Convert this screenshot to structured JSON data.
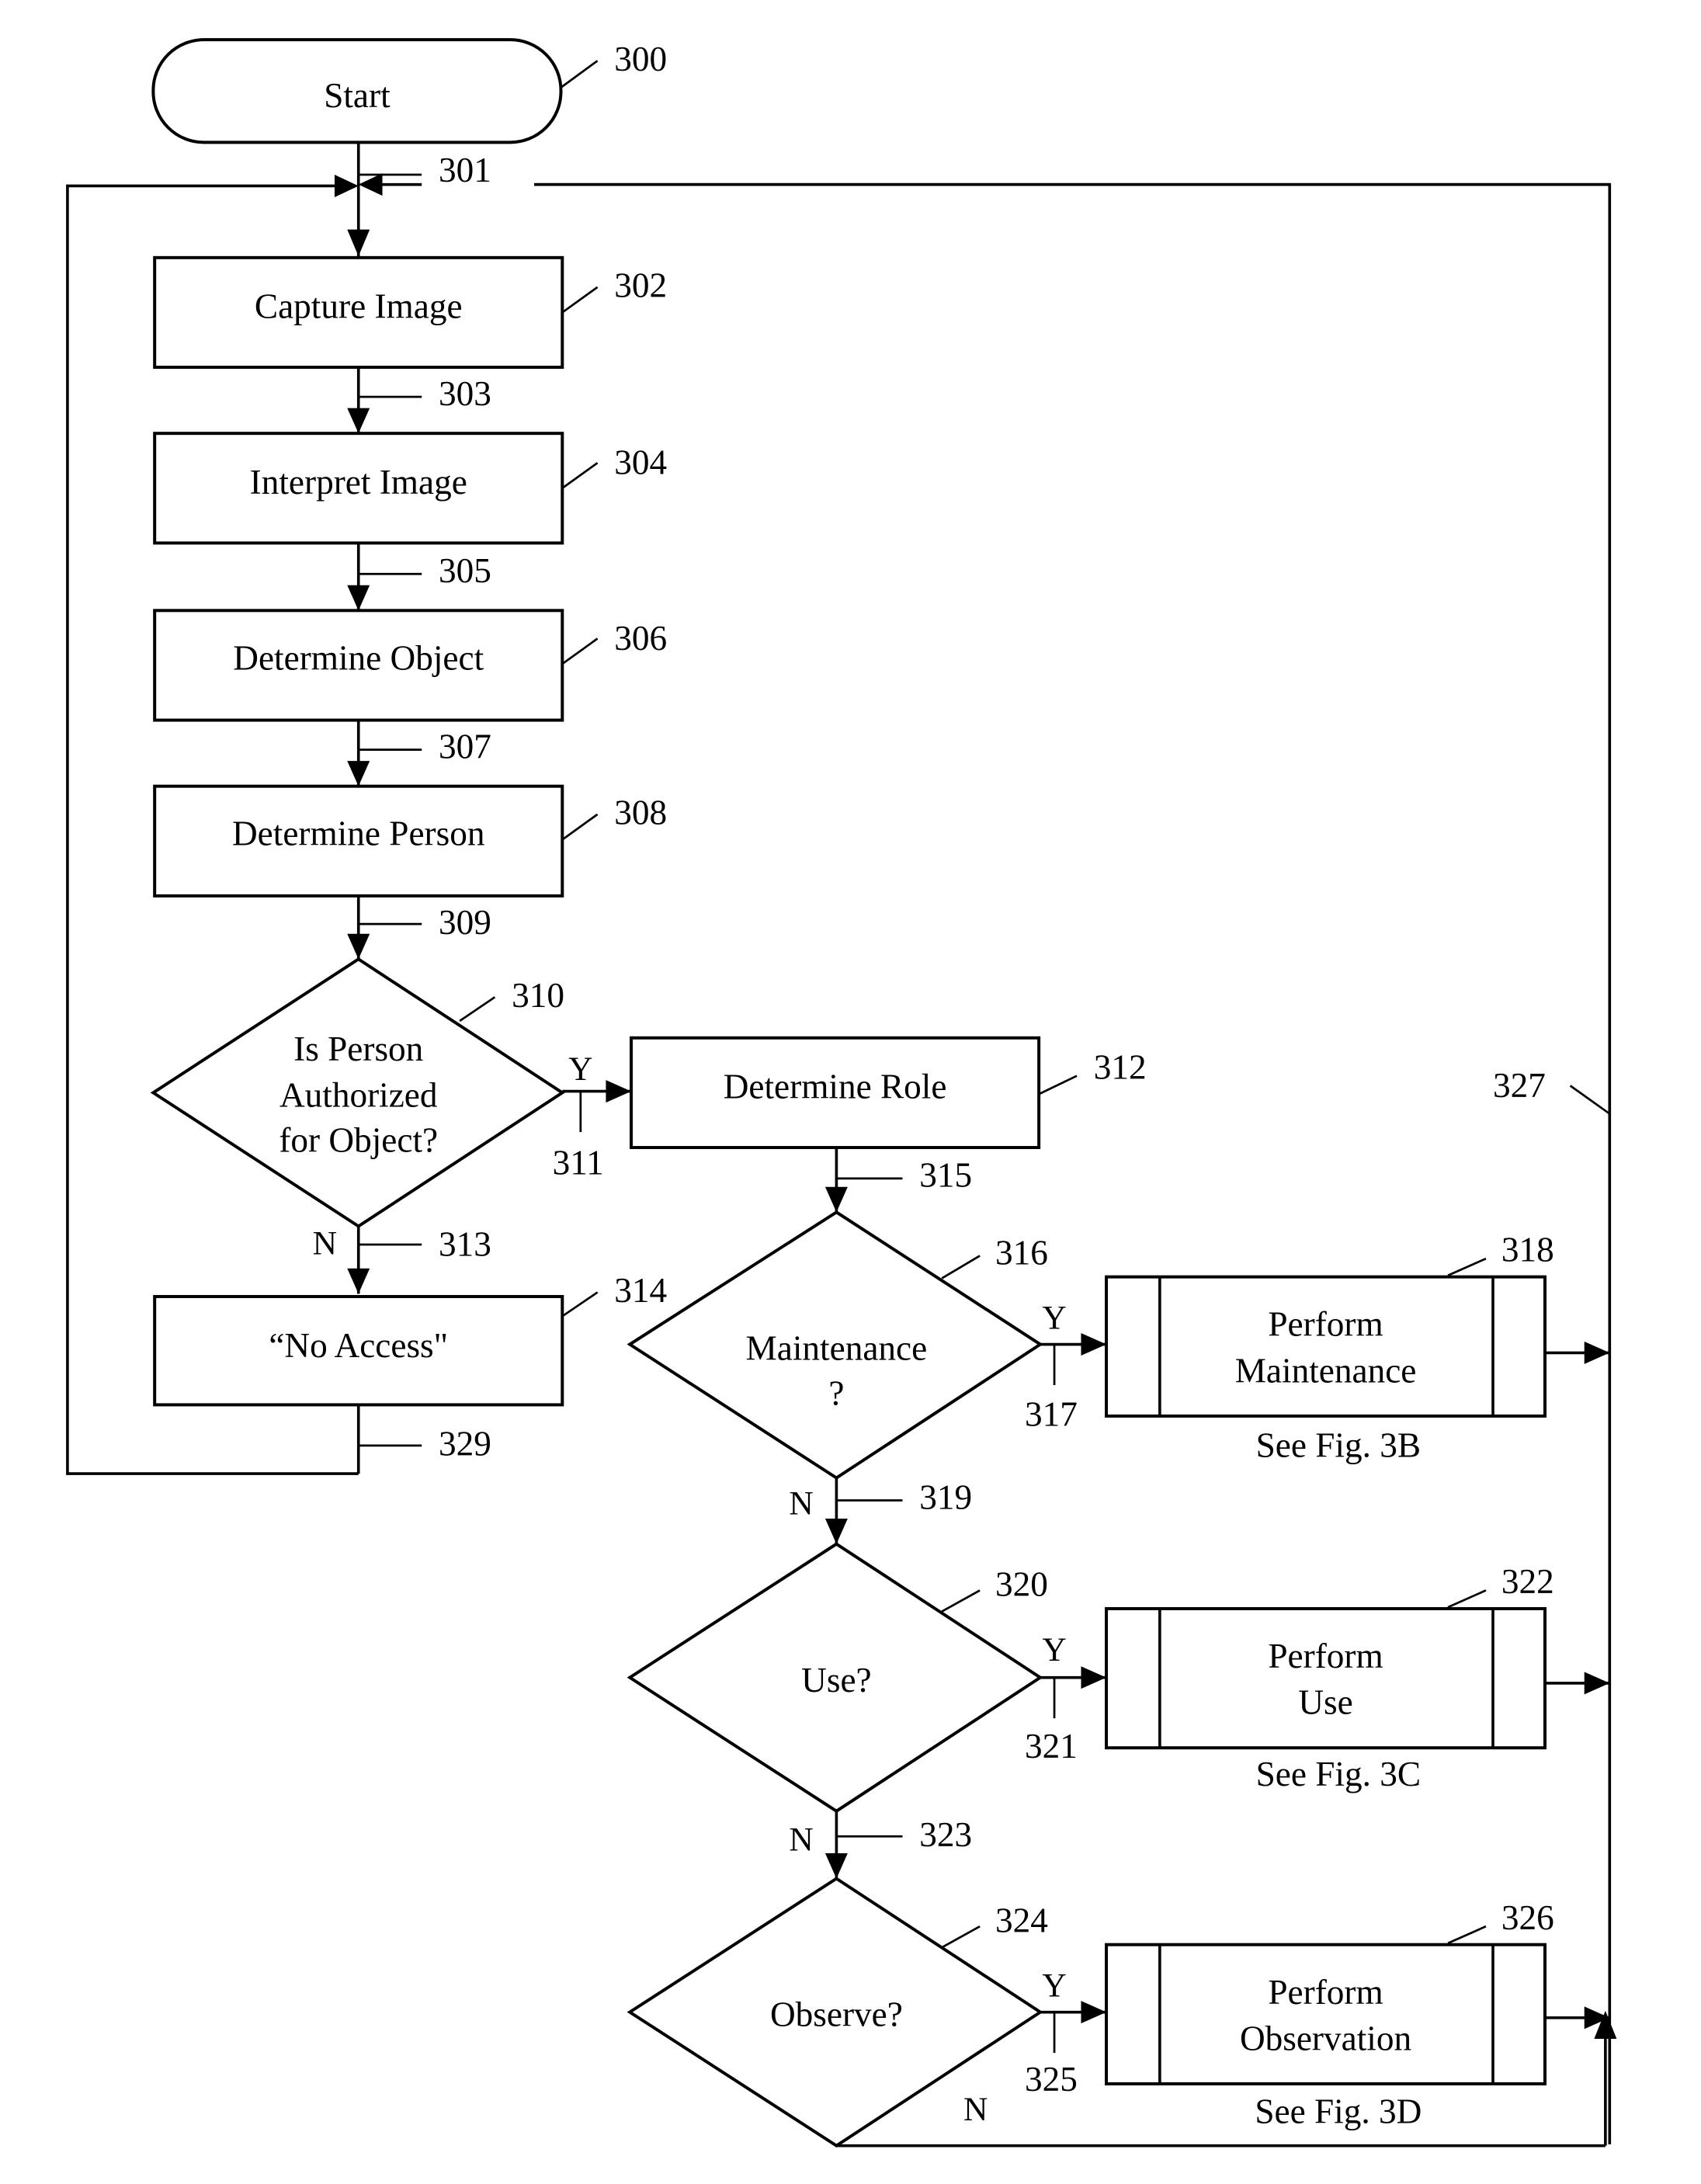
{
  "figure": {
    "start": {
      "text": "Start",
      "ref": "300"
    },
    "steps": [
      {
        "id": "capture",
        "text": "Capture Image",
        "ref": "302"
      },
      {
        "id": "interpret",
        "text": "Interpret Image",
        "ref": "304"
      },
      {
        "id": "object",
        "text": "Determine Object",
        "ref": "306"
      },
      {
        "id": "person",
        "text": "Determine Person",
        "ref": "308"
      },
      {
        "id": "role",
        "text": "Determine Role",
        "ref": "312"
      },
      {
        "id": "noaccess",
        "text": "“No Access\"",
        "ref": "314"
      }
    ],
    "decisions": [
      {
        "id": "authorized",
        "lines": [
          "Is Person",
          "Authorized",
          "for Object?"
        ],
        "ref": "310"
      },
      {
        "id": "maintenance",
        "lines": [
          "Maintenance",
          "?"
        ],
        "ref": "316"
      },
      {
        "id": "use",
        "lines": [
          "Use?"
        ],
        "ref": "320"
      },
      {
        "id": "observe",
        "lines": [
          "Observe?"
        ],
        "ref": "324"
      }
    ],
    "subprocesses": [
      {
        "id": "perform-maintenance",
        "lines": [
          "Perform",
          "Maintenance"
        ],
        "ref": "318",
        "see": "See Fig. 3B"
      },
      {
        "id": "perform-use",
        "lines": [
          "Perform",
          "Use"
        ],
        "ref": "322",
        "see": "See Fig. 3C"
      },
      {
        "id": "perform-observation",
        "lines": [
          "Perform",
          "Observation"
        ],
        "ref": "326",
        "see": "See Fig. 3D"
      }
    ],
    "connector_refs": {
      "r301": "301",
      "r303": "303",
      "r305": "305",
      "r307": "307",
      "r309": "309",
      "r311": "311",
      "r313": "313",
      "r315": "315",
      "r317": "317",
      "r319": "319",
      "r321": "321",
      "r323": "323",
      "r325": "325",
      "r327": "327",
      "r329": "329"
    },
    "branch_labels": {
      "yes": "Y",
      "no": "N"
    }
  }
}
